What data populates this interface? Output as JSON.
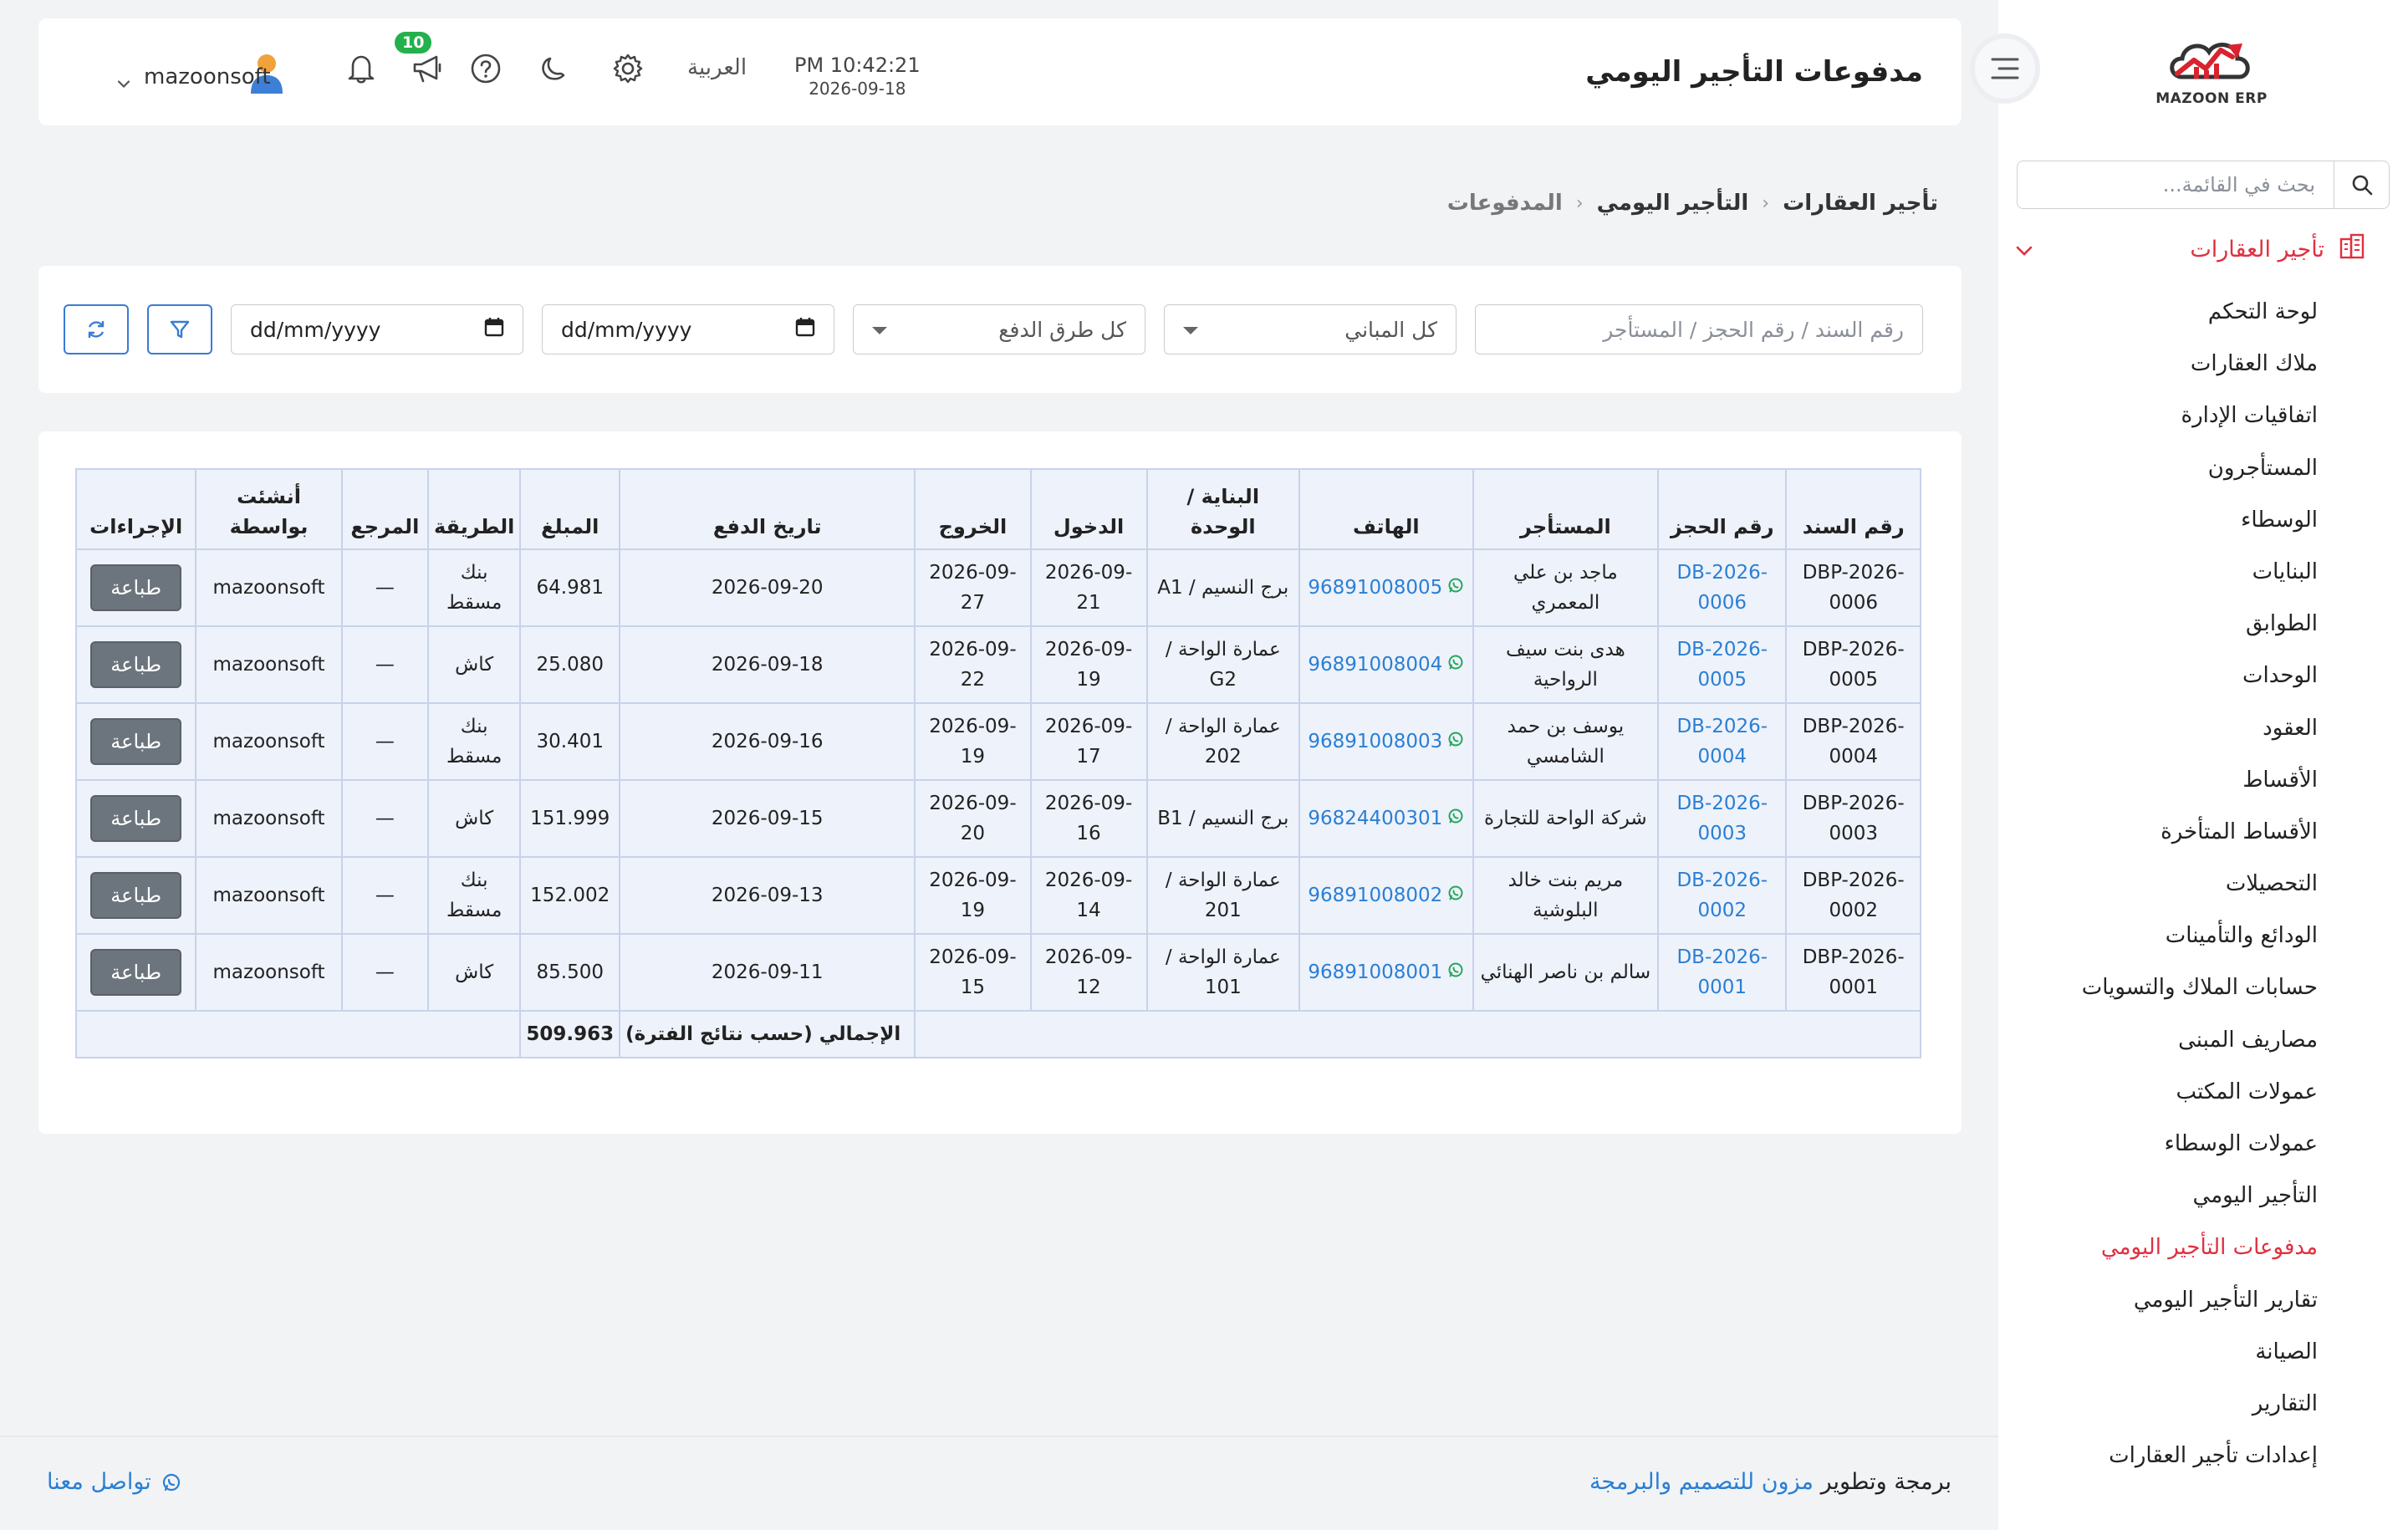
{
  "sidebar": {
    "logo_text": "MAZOON ERP",
    "search_placeholder": "بحث في القائمة...",
    "section_label": "تأجير العقارات",
    "items": [
      {
        "label": "لوحة التحكم"
      },
      {
        "label": "ملاك العقارات"
      },
      {
        "label": "اتفاقيات الإدارة"
      },
      {
        "label": "المستأجرون"
      },
      {
        "label": "الوسطاء"
      },
      {
        "label": "البنايات"
      },
      {
        "label": "الطوابق"
      },
      {
        "label": "الوحدات"
      },
      {
        "label": "العقود"
      },
      {
        "label": "الأقساط"
      },
      {
        "label": "الأقساط المتأخرة"
      },
      {
        "label": "التحصيلات"
      },
      {
        "label": "الودائع والتأمينات"
      },
      {
        "label": "حسابات الملاك والتسويات"
      },
      {
        "label": "مصاريف المبنى"
      },
      {
        "label": "عمولات المكتب"
      },
      {
        "label": "عمولات الوسطاء"
      },
      {
        "label": "التأجير اليومي"
      },
      {
        "label": "مدفوعات التأجير اليومي"
      },
      {
        "label": "تقارير التأجير اليومي"
      },
      {
        "label": "الصيانة"
      },
      {
        "label": "التقارير"
      },
      {
        "label": "إعدادات تأجير العقارات"
      }
    ],
    "active_index": 18,
    "accent_color": "#e03040"
  },
  "header": {
    "title": "مدفوعات التأجير اليومي",
    "time": "PM 10:42:21",
    "date": "2026-09-18",
    "language": "العربية",
    "notification_count": "10",
    "username": "mazoonsoft"
  },
  "breadcrumb": {
    "items": [
      "تأجير العقارات",
      "التأجير اليومي",
      "المدفوعات"
    ]
  },
  "filters": {
    "search_placeholder": "رقم السند / رقم الحجز / المستأجر",
    "building_select": "كل المباني",
    "payment_method_select": "كل طرق الدفع",
    "date_from_placeholder": "dd/mm/yyyy",
    "date_to_placeholder": "dd/mm/yyyy"
  },
  "table": {
    "headers": [
      "رقم السند",
      "رقم الحجز",
      "المستأجر",
      "الهاتف",
      "البناية / الوحدة",
      "الدخول",
      "الخروج",
      "تاريخ الدفع",
      "المبلغ",
      "الطريقة",
      "المرجع",
      "أنشئت بواسطة",
      "الإجراءات"
    ],
    "print_label": "طباعة",
    "rows": [
      {
        "voucher": "DBP-2026-0006",
        "booking": "DB-2026-0006",
        "tenant": "ماجد بن علي المعمري",
        "phone": "96891008005",
        "unit": "برج النسيم / A1",
        "checkin": "2026-09-21",
        "checkout": "2026-09-27",
        "paid": "2026-09-20",
        "amount": "64.981",
        "method": "بنك مسقط",
        "ref": "—",
        "by": "mazoonsoft"
      },
      {
        "voucher": "DBP-2026-0005",
        "booking": "DB-2026-0005",
        "tenant": "هدى بنت سيف الرواحية",
        "phone": "96891008004",
        "unit": "عمارة الواحة / G2",
        "checkin": "2026-09-19",
        "checkout": "2026-09-22",
        "paid": "2026-09-18",
        "amount": "25.080",
        "method": "كاش",
        "ref": "—",
        "by": "mazoonsoft"
      },
      {
        "voucher": "DBP-2026-0004",
        "booking": "DB-2026-0004",
        "tenant": "يوسف بن حمد الشامسي",
        "phone": "96891008003",
        "unit": "عمارة الواحة / 202",
        "checkin": "2026-09-17",
        "checkout": "2026-09-19",
        "paid": "2026-09-16",
        "amount": "30.401",
        "method": "بنك مسقط",
        "ref": "—",
        "by": "mazoonsoft"
      },
      {
        "voucher": "DBP-2026-0003",
        "booking": "DB-2026-0003",
        "tenant": "شركة الواحة للتجارة",
        "phone": "96824400301",
        "unit": "برج النسيم / B1",
        "checkin": "2026-09-16",
        "checkout": "2026-09-20",
        "paid": "2026-09-15",
        "amount": "151.999",
        "method": "كاش",
        "ref": "—",
        "by": "mazoonsoft"
      },
      {
        "voucher": "DBP-2026-0002",
        "booking": "DB-2026-0002",
        "tenant": "مريم بنت خالد البلوشية",
        "phone": "96891008002",
        "unit": "عمارة الواحة / 201",
        "checkin": "2026-09-14",
        "checkout": "2026-09-19",
        "paid": "2026-09-13",
        "amount": "152.002",
        "method": "بنك مسقط",
        "ref": "—",
        "by": "mazoonsoft"
      },
      {
        "voucher": "DBP-2026-0001",
        "booking": "DB-2026-0001",
        "tenant": "سالم بن ناصر الهنائي",
        "phone": "96891008001",
        "unit": "عمارة الواحة / 101",
        "checkin": "2026-09-12",
        "checkout": "2026-09-15",
        "paid": "2026-09-11",
        "amount": "85.500",
        "method": "كاش",
        "ref": "—",
        "by": "mazoonsoft"
      }
    ],
    "total_label": "الإجمالي (حسب نتائج الفترة)",
    "total_amount": "509.963"
  },
  "footer": {
    "credit_prefix": "برمجة وتطوير",
    "credit_developer": "مزون للتصميم والبرمجة",
    "contact_label": "تواصل معنا"
  },
  "icons": [
    "search-icon",
    "building-icon",
    "chevron-down-icon",
    "menu-icon",
    "settings-icon",
    "moon-icon",
    "help-icon",
    "megaphone-icon",
    "bell-icon",
    "filter-icon",
    "refresh-icon",
    "calendar-icon",
    "whatsapp-icon"
  ]
}
